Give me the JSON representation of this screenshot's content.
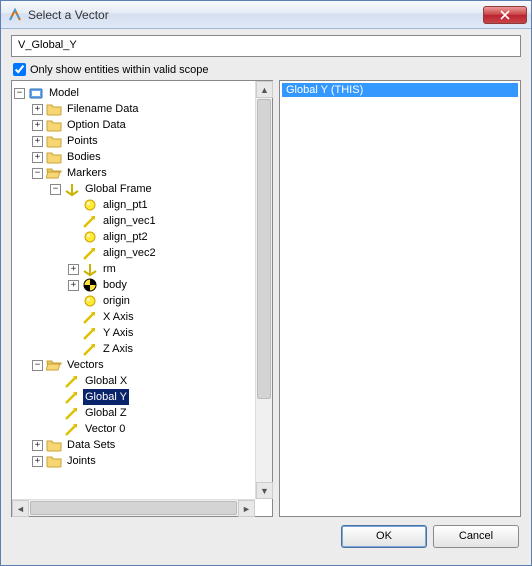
{
  "window": {
    "title": "Select a Vector",
    "close_glyph": "✕"
  },
  "name_field": {
    "value": "V_Global_Y"
  },
  "scope_checkbox": {
    "label": "Only show entities within valid scope",
    "checked": true
  },
  "list": {
    "items": [
      {
        "label": "Global Y (THIS)",
        "selected": true
      }
    ]
  },
  "tree": {
    "root": {
      "label": "Model",
      "icon": "model",
      "expanded": true,
      "children": [
        {
          "label": "Filename Data",
          "icon": "folder",
          "expanded": false,
          "has_children": true
        },
        {
          "label": "Option Data",
          "icon": "folder",
          "expanded": false,
          "has_children": true
        },
        {
          "label": "Points",
          "icon": "folder",
          "expanded": false,
          "has_children": true
        },
        {
          "label": "Bodies",
          "icon": "folder",
          "expanded": false,
          "has_children": true
        },
        {
          "label": "Markers",
          "icon": "folder",
          "expanded": true,
          "children": [
            {
              "label": "Global Frame",
              "icon": "axis",
              "expanded": true,
              "children": [
                {
                  "label": "align_pt1",
                  "icon": "sphere"
                },
                {
                  "label": "align_vec1",
                  "icon": "vector"
                },
                {
                  "label": "align_pt2",
                  "icon": "sphere"
                },
                {
                  "label": "align_vec2",
                  "icon": "vector"
                },
                {
                  "label": "rm",
                  "icon": "axis",
                  "expanded": false,
                  "has_children": true
                },
                {
                  "label": "body",
                  "icon": "body",
                  "expanded": false,
                  "has_children": true
                },
                {
                  "label": "origin",
                  "icon": "sphere"
                },
                {
                  "label": "X Axis",
                  "icon": "vector"
                },
                {
                  "label": "Y Axis",
                  "icon": "vector"
                },
                {
                  "label": "Z Axis",
                  "icon": "vector"
                }
              ]
            }
          ]
        },
        {
          "label": "Vectors",
          "icon": "folder",
          "expanded": true,
          "children": [
            {
              "label": "Global X",
              "icon": "vector"
            },
            {
              "label": "Global Y",
              "icon": "vector",
              "selected": true
            },
            {
              "label": "Global Z",
              "icon": "vector"
            },
            {
              "label": "Vector 0",
              "icon": "vector"
            }
          ]
        },
        {
          "label": "Data Sets",
          "icon": "folder",
          "expanded": false,
          "has_children": true
        },
        {
          "label": "Joints",
          "icon": "folder",
          "expanded": false,
          "has_children": true
        }
      ]
    }
  },
  "buttons": {
    "ok": "OK",
    "cancel": "Cancel"
  },
  "scrollbar": {
    "left": "◄",
    "right": "►",
    "up": "▲",
    "down": "▼"
  }
}
